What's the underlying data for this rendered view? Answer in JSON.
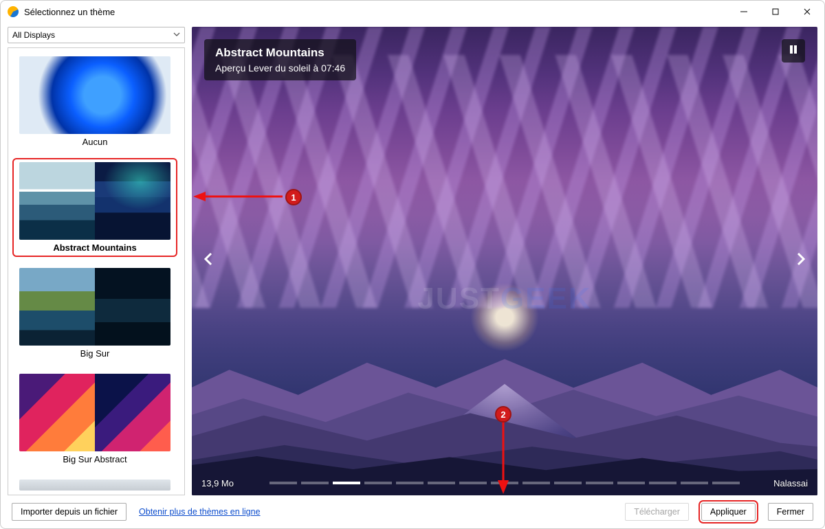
{
  "window": {
    "title": "Sélectionnez un thème"
  },
  "sidebar": {
    "display_selector": "All Displays",
    "themes": [
      {
        "label": "Aucun"
      },
      {
        "label": "Abstract Mountains"
      },
      {
        "label": "Big Sur"
      },
      {
        "label": "Big Sur Abstract"
      }
    ],
    "selected_index": 1
  },
  "preview": {
    "title": "Abstract Mountains",
    "subtitle": "Aperçu Lever du soleil à 07:46",
    "size_label": "13,9 Mo",
    "author": "Nalassai",
    "dot_count": 15,
    "active_dot": 2,
    "watermark_a": "JUST",
    "watermark_b": "GEEK"
  },
  "footer": {
    "import_label": "Importer depuis un fichier",
    "more_link": "Obtenir plus de thèmes en ligne",
    "download_label": "Télécharger",
    "apply_label": "Appliquer",
    "close_label": "Fermer"
  },
  "annotations": {
    "badge1": "1",
    "badge2": "2"
  }
}
